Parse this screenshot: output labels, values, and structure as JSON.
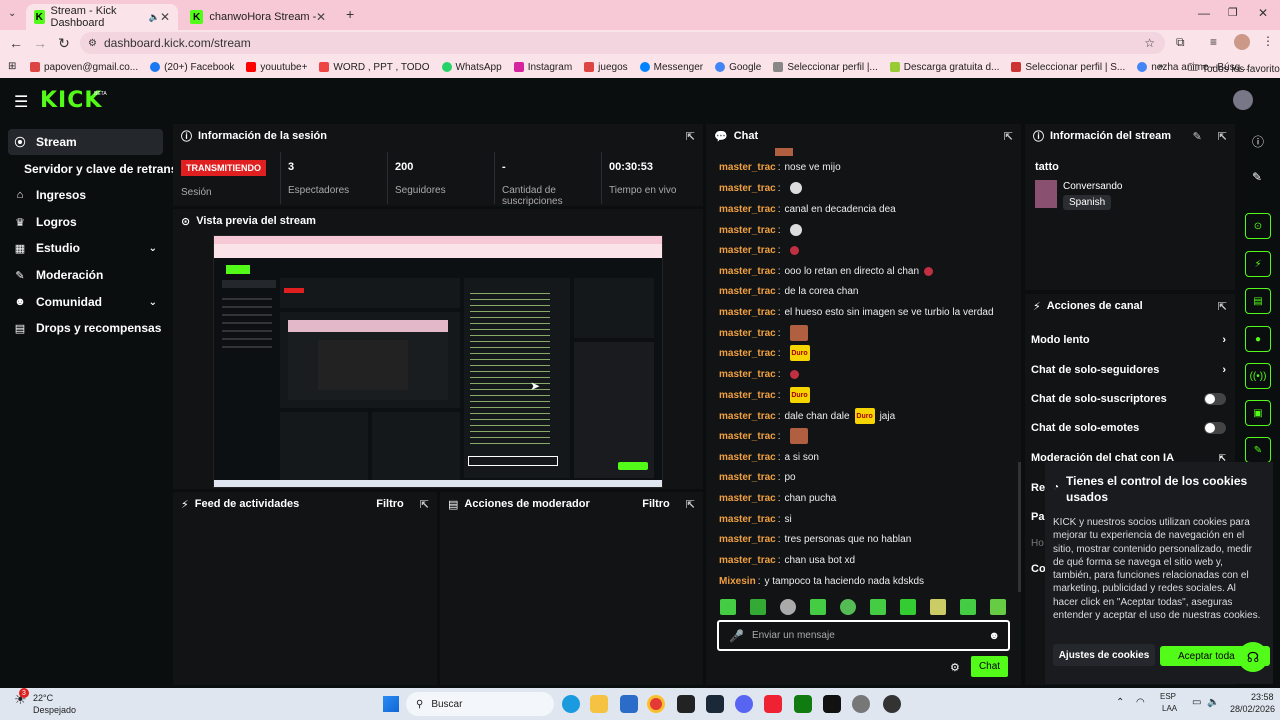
{
  "browser": {
    "tabs": [
      {
        "title": "Stream - Kick Dashboard",
        "active": true
      },
      {
        "title": "chanwoHora Stream - Watch Li",
        "active": false
      }
    ],
    "url": "dashboard.kick.com/stream",
    "bookmarks": [
      "papoven@gmail.co...",
      "(20+) Facebook",
      "youutube+",
      "WORD , PPT , TODO",
      "WhatsApp",
      "Instagram",
      "juegos",
      "Messenger",
      "Google",
      "Seleccionar perfil |...",
      "Descarga gratuita d...",
      "Seleccionar perfil | S...",
      "nezha anime - Búsq..."
    ],
    "all_favorites": "Todos los favoritos"
  },
  "kick": {
    "logo": "KICK",
    "beta": "BETA"
  },
  "sidebar": {
    "items": [
      {
        "label": "Stream",
        "icon": "stream-icon"
      },
      {
        "label": "Servidor y clave de retransm"
      },
      {
        "label": "Ingresos",
        "icon": "bank-icon"
      },
      {
        "label": "Logros",
        "icon": "trophy-icon"
      },
      {
        "label": "Estudio",
        "icon": "studio-icon"
      },
      {
        "label": "Moderación",
        "icon": "wrench-icon"
      },
      {
        "label": "Comunidad",
        "icon": "community-icon"
      },
      {
        "label": "Drops y recompensas",
        "icon": "gift-icon"
      }
    ]
  },
  "session": {
    "title": "Información de la sesión",
    "status": "TRANSMITIENDO",
    "status_label": "Sesión",
    "stats": [
      {
        "value": "3",
        "label": "Espectadores"
      },
      {
        "value": "200",
        "label": "Seguidores"
      },
      {
        "value": "-",
        "label": "Cantidad de suscripciones"
      },
      {
        "value": "00:30:53",
        "label": "Tiempo en vivo"
      }
    ]
  },
  "preview": {
    "title": "Vista previa del stream"
  },
  "activity": {
    "title": "Feed de actividades",
    "filter": "Filtro"
  },
  "modactions": {
    "title": "Acciones de moderador",
    "filter": "Filtro"
  },
  "chat": {
    "title": "Chat",
    "messages": [
      {
        "user": "master_trac",
        "text": "nose ve mijo"
      },
      {
        "user": "master_trac",
        "text": ""
      },
      {
        "user": "master_trac",
        "text": "canal en decadencia dea"
      },
      {
        "user": "master_trac",
        "text": ""
      },
      {
        "user": "master_trac",
        "text": ""
      },
      {
        "user": "master_trac",
        "text": "ooo lo retan en directo al chan"
      },
      {
        "user": "master_trac",
        "text": "de la corea chan"
      },
      {
        "user": "master_trac",
        "text": "el hueso esto sin imagen se ve turbio la verdad"
      },
      {
        "user": "master_trac",
        "text": ""
      },
      {
        "user": "master_trac",
        "text": ""
      },
      {
        "user": "master_trac",
        "text": ""
      },
      {
        "user": "master_trac",
        "text": ""
      },
      {
        "user": "master_trac",
        "text": "dale chan dale"
      },
      {
        "user": "master_trac",
        "text": ""
      },
      {
        "user": "master_trac",
        "text": "a si son"
      },
      {
        "user": "master_trac",
        "text": "po"
      },
      {
        "user": "master_trac",
        "text": "chan pucha"
      },
      {
        "user": "master_trac",
        "text": "si"
      },
      {
        "user": "master_trac",
        "text": "tres personas que no hablan"
      },
      {
        "user": "master_trac",
        "text": "chan usa bot xd"
      },
      {
        "user": "Mixesin",
        "text": "y tampoco ta haciendo nada kdskds"
      }
    ],
    "emote_word": "Duro",
    "suffix": "jaja",
    "placeholder": "Enviar un mensaje",
    "send": "Chat"
  },
  "stream_info": {
    "title": "Información del stream",
    "stream_title": "tatto",
    "category": "Conversando",
    "language": "Spanish"
  },
  "channel_actions": {
    "title": "Acciones de canal",
    "rows": [
      "Modo lento",
      "Chat de solo-seguidores",
      "Chat de solo-suscriptores",
      "Chat de solo-emotes",
      "Moderación del chat con IA"
    ],
    "partial": [
      "Re",
      "Pa",
      "Ho",
      "Co"
    ]
  },
  "cookie": {
    "title": "Tienes el control de los cookies usados",
    "body": "KICK y nuestros socios utilizan cookies para mejorar tu experiencia de navegación en el sitio, mostrar contenido personalizado, medir de qué forma se navega el sitio web y, también, para funciones relacionadas con el marketing, publicidad y redes sociales. Al hacer click en \"Aceptar todas\", aseguras entender y aceptar el uso de nuestras cookies.",
    "settings": "Ajustes de cookies",
    "accept": "Aceptar toda"
  },
  "taskbar": {
    "weather_temp": "22°C",
    "weather_desc": "Despejado",
    "notif": "3",
    "search": "Buscar",
    "lang1": "ESP",
    "lang2": "LAA",
    "time": "23:58",
    "date": "28/02/2026"
  },
  "colors": {
    "accent": "#53fc18",
    "live": "#e02020",
    "user": "#f0a040"
  }
}
